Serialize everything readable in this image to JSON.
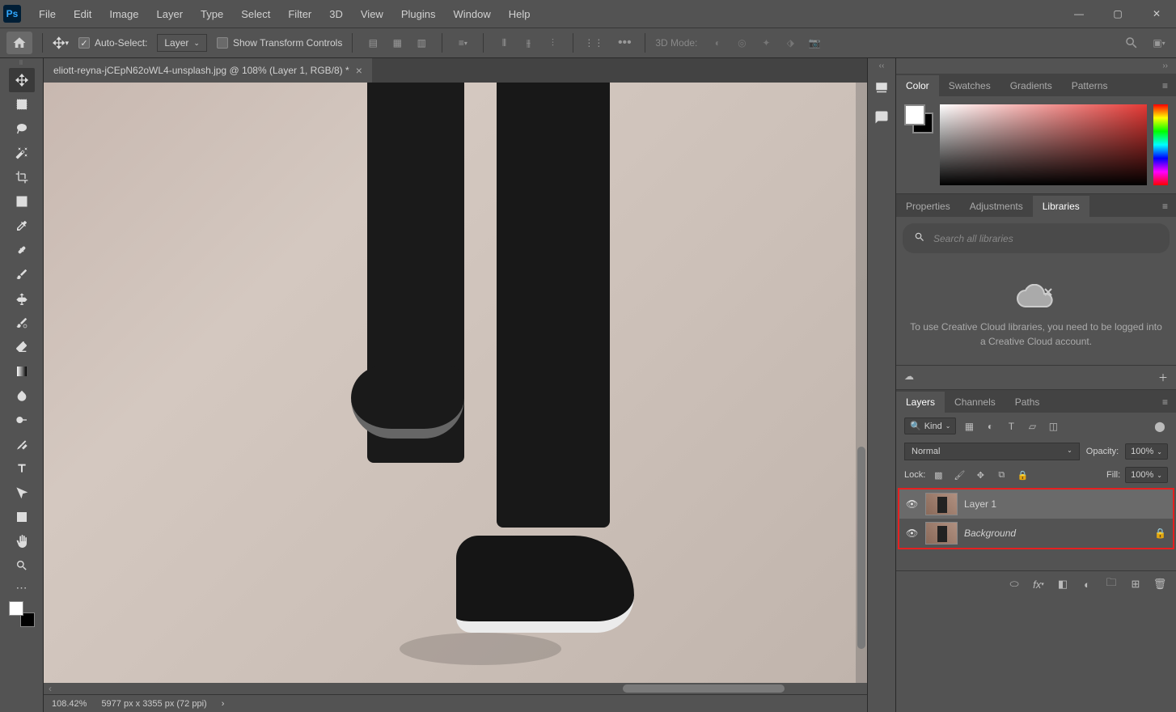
{
  "menu": {
    "file": "File",
    "edit": "Edit",
    "image": "Image",
    "layer": "Layer",
    "type": "Type",
    "select": "Select",
    "filter": "Filter",
    "threeD": "3D",
    "view": "View",
    "plugins": "Plugins",
    "window": "Window",
    "help": "Help"
  },
  "options": {
    "autoSelect": "Auto-Select:",
    "target": "Layer",
    "showTransform": "Show Transform Controls",
    "threeDMode": "3D Mode:"
  },
  "document": {
    "tab": "eliott-reyna-jCEpN62oWL4-unsplash.jpg @ 108% (Layer 1, RGB/8) *",
    "zoom": "108.42%",
    "dims": "5977 px x 3355 px (72 ppi)"
  },
  "panels": {
    "color": {
      "tab1": "Color",
      "tab2": "Swatches",
      "tab3": "Gradients",
      "tab4": "Patterns"
    },
    "props": {
      "tab1": "Properties",
      "tab2": "Adjustments",
      "tab3": "Libraries",
      "searchPlaceholder": "Search all libraries",
      "message": "To use Creative Cloud libraries, you need to be logged into a Creative Cloud account."
    },
    "layers": {
      "tab1": "Layers",
      "tab2": "Channels",
      "tab3": "Paths",
      "kind": "Kind",
      "blend": "Normal",
      "opacityLabel": "Opacity:",
      "opacity": "100%",
      "lockLabel": "Lock:",
      "fillLabel": "Fill:",
      "fill": "100%",
      "items": [
        {
          "name": "Layer 1",
          "locked": false
        },
        {
          "name": "Background",
          "locked": true
        }
      ]
    }
  }
}
